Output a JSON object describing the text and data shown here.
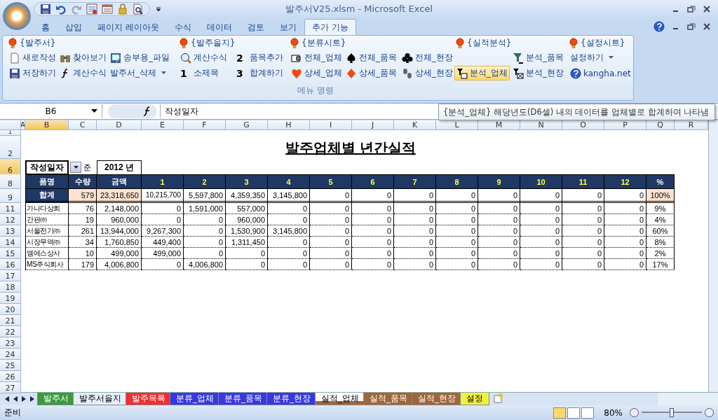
{
  "window": {
    "title": "발주서V25.xlsm - Microsoft Excel"
  },
  "ribbon_tabs": [
    {
      "label": "홈",
      "selected": false
    },
    {
      "label": "삽입",
      "selected": false
    },
    {
      "label": "페이지 레이아웃",
      "selected": false
    },
    {
      "label": "수식",
      "selected": false
    },
    {
      "label": "데이터",
      "selected": false
    },
    {
      "label": "검토",
      "selected": false
    },
    {
      "label": "보기",
      "selected": false
    },
    {
      "label": "추가 기능",
      "selected": true
    }
  ],
  "ribbon": {
    "headings": [
      "{발주서}",
      "{발주을지}",
      "{분류시트}",
      "{실적분석}",
      "{설정시트}"
    ],
    "columns": [
      [
        {
          "label": "새로작성",
          "highlighted": false
        },
        {
          "label": "저장하기",
          "highlighted": false
        }
      ],
      [
        {
          "label": "찾아보기",
          "highlighted": false
        },
        {
          "label": "계산수식",
          "highlighted": false
        }
      ],
      [
        {
          "label": "송부용_파일",
          "highlighted": false
        },
        {
          "label": "발주서_삭제",
          "dropdown": true,
          "highlighted": false
        }
      ],
      [
        {
          "label": "계산수식",
          "highlighted": false
        },
        {
          "number": "1",
          "label": "소제목",
          "highlighted": false
        }
      ],
      [
        {
          "number": "2",
          "label": "품목추가",
          "highlighted": false
        },
        {
          "number": "3",
          "label": "합계하기",
          "highlighted": false
        }
      ],
      [
        {
          "label": "전체_업체",
          "highlighted": false
        },
        {
          "label": "상세_업체",
          "highlighted": false
        }
      ],
      [
        {
          "label": "전체_품목",
          "highlighted": false
        },
        {
          "label": "상세_품목",
          "highlighted": false
        }
      ],
      [
        {
          "label": "전체_현장",
          "highlighted": false
        },
        {
          "label": "상세_현장",
          "highlighted": false
        }
      ],
      [
        {
          "label": "분석_업체",
          "highlighted": true
        }
      ],
      [
        {
          "label": "분석_품목",
          "highlighted": false
        },
        {
          "label": "분석_현장",
          "highlighted": false
        }
      ],
      [
        {
          "label": "설정하기",
          "dropdown": true,
          "highlighted": false
        },
        {
          "label": "kangha.net",
          "highlighted": false
        }
      ]
    ],
    "group_label": "메뉴 명령"
  },
  "formula_bar": {
    "name_box": "B6",
    "formula": "작성일자"
  },
  "tooltip": "{분석_업체} 해당년도(D6셀) 내의 데이터를 업체별로 합계하여 나타냄",
  "column_headers": [
    {
      "label": "A",
      "selected": false
    },
    {
      "label": "B",
      "selected": true
    },
    {
      "label": "C",
      "selected": false
    },
    {
      "label": "D",
      "selected": false
    },
    {
      "label": "E",
      "selected": false
    },
    {
      "label": "F",
      "selected": false
    },
    {
      "label": "G",
      "selected": false
    },
    {
      "label": "H",
      "selected": false
    },
    {
      "label": "I",
      "selected": false
    },
    {
      "label": "J",
      "selected": false
    },
    {
      "label": "K",
      "selected": false
    },
    {
      "label": "L",
      "selected": false
    },
    {
      "label": "M",
      "selected": false
    },
    {
      "label": "N",
      "selected": false
    },
    {
      "label": "O",
      "selected": false
    },
    {
      "label": "P",
      "selected": false
    },
    {
      "label": "Q",
      "selected": false
    },
    {
      "label": "R",
      "selected": false
    }
  ],
  "rows": [
    {
      "number": "1",
      "kind": "spacer",
      "selected": false
    },
    {
      "number": "2",
      "kind": "title",
      "selected": false,
      "title": "발주업체별 년간실적"
    },
    {
      "number": "6",
      "kind": "criteria",
      "selected": true,
      "criteria": "작성일자",
      "suffix": "준",
      "year": "2012 년"
    },
    {
      "number": "8",
      "kind": "header",
      "selected": false,
      "cells": [
        "품명",
        "수량",
        "금액",
        "1",
        "2",
        "3",
        "4",
        "5",
        "6",
        "7",
        "8",
        "9",
        "10",
        "11",
        "12",
        "%"
      ]
    },
    {
      "number": "9",
      "kind": "total",
      "selected": false,
      "cells": [
        "합계",
        "579",
        "23,318,650",
        "10,215,700",
        "5,597,800",
        "4,359,350",
        "3,145,800",
        "0",
        "0",
        "0",
        "0",
        "0",
        "0",
        "0",
        "0",
        "100%"
      ]
    },
    {
      "number": "11",
      "kind": "data",
      "selected": false,
      "cells": [
        "가나다상회",
        "76",
        "2,148,000",
        "0",
        "1,591,000",
        "557,000",
        "0",
        "0",
        "0",
        "0",
        "0",
        "0",
        "0",
        "0",
        "0",
        "9%"
      ]
    },
    {
      "number": "12",
      "kind": "data",
      "selected": false,
      "cells": [
        "간판㈜",
        "19",
        "960,000",
        "0",
        "0",
        "960,000",
        "0",
        "0",
        "0",
        "0",
        "0",
        "0",
        "0",
        "0",
        "0",
        "4%"
      ]
    },
    {
      "number": "13",
      "kind": "data",
      "selected": false,
      "cells": [
        "서울전기㈜",
        "261",
        "13,944,000",
        "9,267,300",
        "0",
        "1,530,900",
        "3,145,800",
        "0",
        "0",
        "0",
        "0",
        "0",
        "0",
        "0",
        "0",
        "60%"
      ]
    },
    {
      "number": "14",
      "kind": "data",
      "selected": false,
      "cells": [
        "시장무역㈜",
        "34",
        "1,760,850",
        "449,400",
        "0",
        "1,311,450",
        "0",
        "0",
        "0",
        "0",
        "0",
        "0",
        "0",
        "0",
        "0",
        "8%"
      ]
    },
    {
      "number": "15",
      "kind": "data",
      "selected": false,
      "cells": [
        "엠에스상사",
        "10",
        "499,000",
        "499,000",
        "0",
        "0",
        "0",
        "0",
        "0",
        "0",
        "0",
        "0",
        "0",
        "0",
        "0",
        "2%"
      ]
    },
    {
      "number": "16",
      "kind": "data",
      "selected": false,
      "cells": [
        "MS주식회사",
        "179",
        "4,006,800",
        "0",
        "4,006,800",
        "0",
        "0",
        "0",
        "0",
        "0",
        "0",
        "0",
        "0",
        "0",
        "0",
        "17%"
      ]
    },
    {
      "number": "17",
      "kind": "empty",
      "selected": false
    },
    {
      "number": "18",
      "kind": "empty",
      "selected": false
    },
    {
      "number": "19",
      "kind": "empty",
      "selected": false
    },
    {
      "number": "20",
      "kind": "empty",
      "selected": false
    },
    {
      "number": "21",
      "kind": "empty",
      "selected": false
    },
    {
      "number": "22",
      "kind": "empty",
      "selected": false
    },
    {
      "number": "23",
      "kind": "empty",
      "selected": false
    },
    {
      "number": "24",
      "kind": "empty",
      "selected": false
    },
    {
      "number": "25",
      "kind": "empty",
      "selected": false
    },
    {
      "number": "26",
      "kind": "empty",
      "selected": false
    },
    {
      "number": "27",
      "kind": "empty",
      "selected": false
    }
  ],
  "sheet_tabs": [
    {
      "label": "발주서",
      "color": "#3c9a3c",
      "selected": false
    },
    {
      "label": "발주서을지",
      "color": "#e6eef8",
      "selected": false
    },
    {
      "label": "발주목록",
      "color": "#ee3030",
      "selected": false
    },
    {
      "label": "분류_업체",
      "color": "#3838e0",
      "selected": false
    },
    {
      "label": "분류_품목",
      "color": "#3838e0",
      "selected": false
    },
    {
      "label": "분류_현장",
      "color": "#3838e0",
      "selected": false
    },
    {
      "label": "실적_업체",
      "color": "#a0663a",
      "selected": true
    },
    {
      "label": "실적_품목",
      "color": "#a0663a",
      "selected": false
    },
    {
      "label": "실적_현장",
      "color": "#a0663a",
      "selected": false
    },
    {
      "label": "설정",
      "color": "#f0f040",
      "selected": false
    }
  ],
  "status_bar": {
    "status": "준비",
    "zoom": "80%",
    "level": 0.5
  }
}
